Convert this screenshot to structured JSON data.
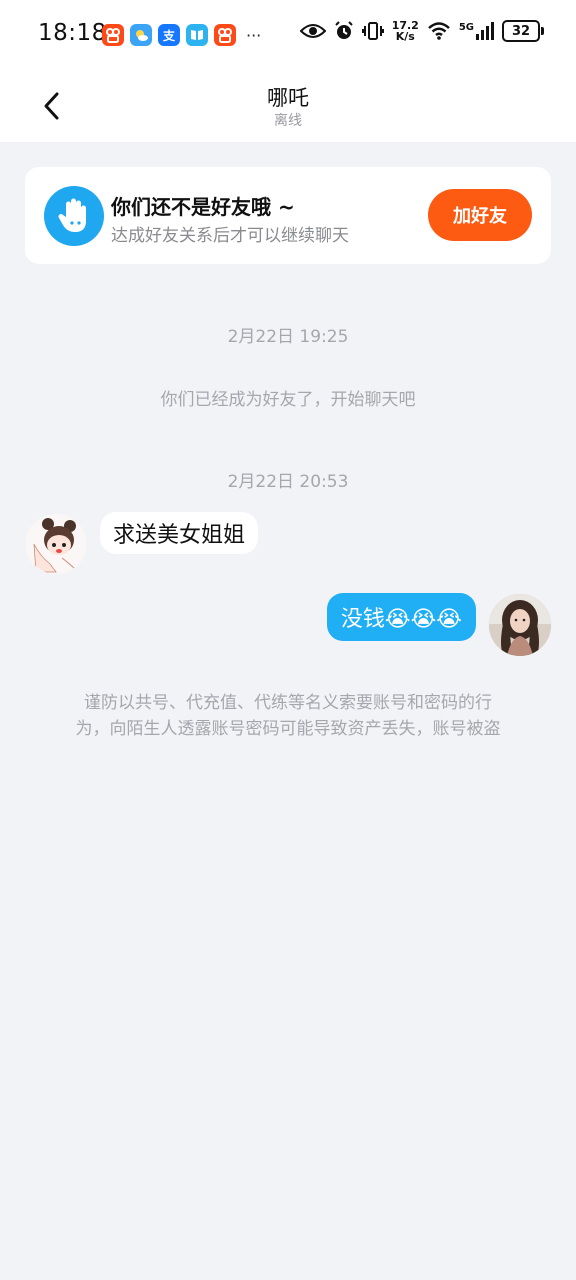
{
  "status_bar": {
    "time": "18:18",
    "more": "···",
    "speed_value": "17.2",
    "speed_unit": "K/s",
    "network": "5G",
    "battery": "32",
    "app_icons": [
      "kuaishou-icon",
      "weather-icon",
      "alipay-icon",
      "reader-icon",
      "kuaishou-icon"
    ]
  },
  "header": {
    "title": "哪吒",
    "subtitle": "离线"
  },
  "friend_card": {
    "title": "你们还不是好友哦 ~",
    "subtitle": "达成好友关系后才可以继续聊天",
    "button": "加好友",
    "button_color": "#fd5a12"
  },
  "chat": {
    "timestamp_1": "2月22日 19:25",
    "system_message": "你们已经成为好友了，开始聊天吧",
    "timestamp_2": "2月22日 20:53",
    "message_incoming": "求送美女姐姐",
    "message_outgoing": "没钱😭😭😭",
    "outgoing_color": "#20aef5",
    "warning_line_1": "谨防以共号、代充值、代练等名义索要账号和密码的行",
    "warning_line_2": "为，向陌生人透露账号密码可能导致资产丢失，账号被盗"
  }
}
